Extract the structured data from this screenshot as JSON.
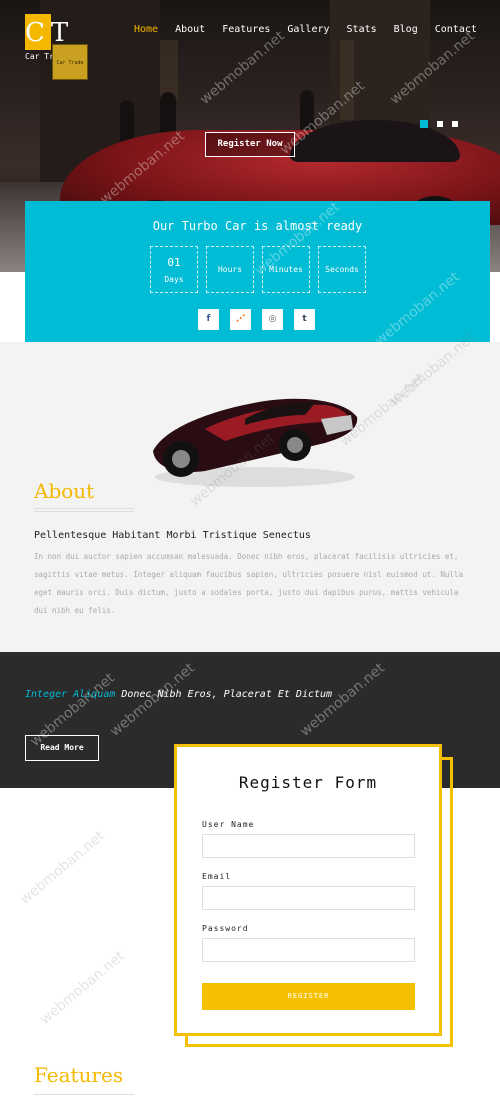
{
  "brand": {
    "logo_letters": "CT",
    "tagline": "Car Trade",
    "sign_text": "Car Trade"
  },
  "nav": {
    "items": [
      "Home",
      "About",
      "Features",
      "Gallery",
      "Stats",
      "Blog",
      "Contact"
    ],
    "active_index": 0
  },
  "hero": {
    "cta_label": "Register Now",
    "slides": 3,
    "active_slide": 0
  },
  "countdown": {
    "title": "Our Turbo Car is almost ready",
    "units": [
      {
        "value": "01",
        "label": "Days"
      },
      {
        "value": "",
        "label": "Hours"
      },
      {
        "value": "",
        "label": "Minutes"
      },
      {
        "value": "",
        "label": "Seconds"
      }
    ]
  },
  "social": [
    {
      "icon": "facebook-icon",
      "glyph": "f",
      "color": "#3b5998"
    },
    {
      "icon": "rss-icon",
      "glyph": "⋰",
      "color": "#ff6600"
    },
    {
      "icon": "instagram-icon",
      "glyph": "◎",
      "color": "#555555"
    },
    {
      "icon": "tumblr-icon",
      "glyph": "t",
      "color": "#35465c"
    }
  ],
  "about": {
    "heading": "About",
    "subheading": "Pellentesque Habitant Morbi Tristique Senectus",
    "body": "In non dui auctor sapien accumsan malesuada. Donec nibh eros, placerat facilisis ultricies et, sagittis vitae metus. Integer aliquam faucibus sapien, ultricies posuere nisl euismod ut. Nulla eget mauris orci. Duis dictum, justo a sodales porta, justo dui dapibus purus, mattis vehicula dui nibh eu felis."
  },
  "band": {
    "highlight": "Integer Aliquam",
    "rest": " Donec Nibh Eros, Placerat Et Dictum",
    "button": "Read More"
  },
  "register_form": {
    "title": "Register Form",
    "fields": [
      {
        "label": "User Name",
        "value": ""
      },
      {
        "label": "Email",
        "value": ""
      },
      {
        "label": "Password",
        "value": ""
      }
    ],
    "submit": "REGISTER"
  },
  "features": {
    "heading": "Features"
  },
  "watermark": "webmoban.net",
  "colors": {
    "accent_yellow": "#f5b800",
    "accent_cyan": "#00bcd4",
    "dark_band": "#2b2b2b"
  }
}
